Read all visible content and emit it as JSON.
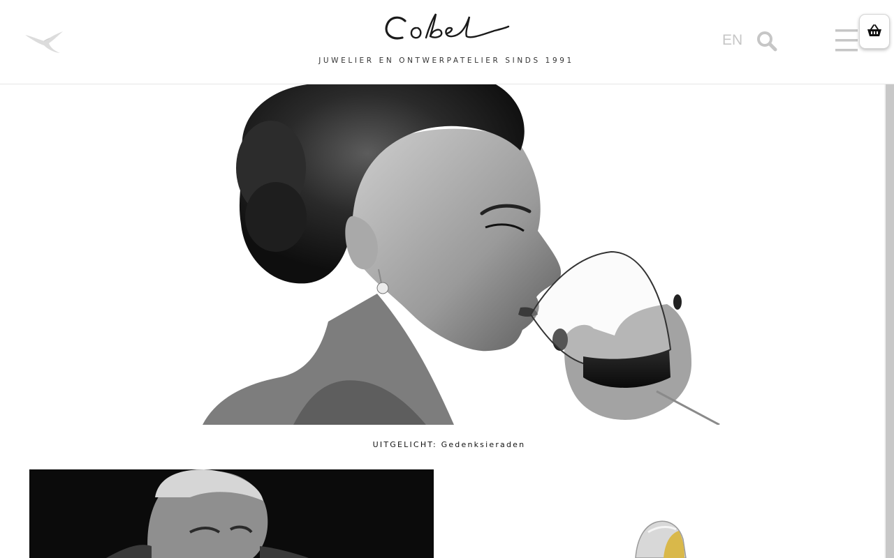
{
  "header": {
    "brand": "Cobel",
    "tagline": "JUWELIER EN ONTWERPATELIER SINDS 1991",
    "language_label": "EN",
    "icons": {
      "logo": "hummingbird-logo",
      "search": "search-icon",
      "menu": "hamburger-menu-icon",
      "cart": "shopping-basket-icon"
    }
  },
  "hero": {
    "image": "black-and-white photo of woman drinking red wine, wearing pearl earring"
  },
  "featured": {
    "caption": "UITGELICHT: Gedenksieraden"
  },
  "tiles": [
    {
      "image": "black-and-white portrait of man"
    },
    {
      "image": "silver and gold ring"
    }
  ],
  "colors": {
    "muted_icon": "#c6c6c6",
    "text": "#222222",
    "border": "#e6e6e6",
    "background": "#ffffff"
  }
}
